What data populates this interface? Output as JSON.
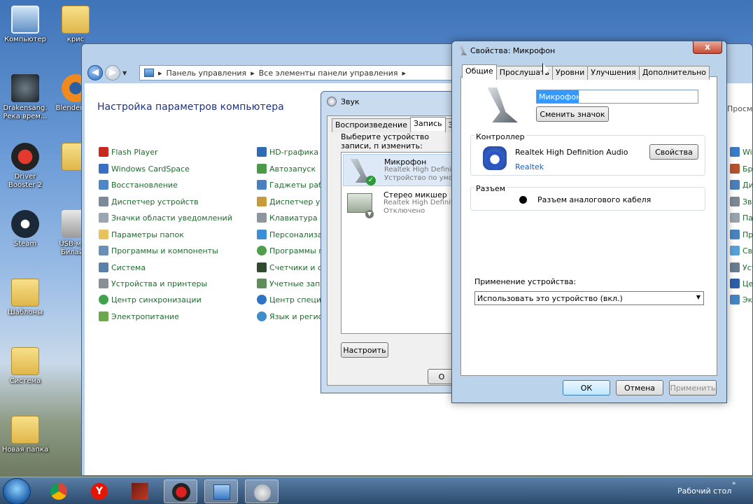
{
  "desktop": {
    "icons": [
      {
        "label": "Компьютер"
      },
      {
        "label": "крис"
      },
      {
        "label": "Drakensang. Река врем..."
      },
      {
        "label": "Blender.e..."
      },
      {
        "label": "Driver Booster 2"
      },
      {
        "label": "Steam"
      },
      {
        "label": "USB-мо... Билай..."
      },
      {
        "label": "Шаблоны"
      },
      {
        "label": "Система"
      },
      {
        "label": "Новая папка"
      }
    ]
  },
  "control_panel": {
    "breadcrumb": [
      "Панель управления",
      "Все элементы панели управления"
    ],
    "title": "Настройка параметров компьютера",
    "right_hint": "Просмо",
    "col1": [
      "Flash Player",
      "Windows CardSpace",
      "Восстановление",
      "Диспетчер устройств",
      "Значки области уведомлений",
      "Параметры папок",
      "Программы и компоненты",
      "Система",
      "Устройства и принтеры",
      "Центр синхронизации",
      "Электропитание"
    ],
    "col2": [
      "HD-графика Int",
      "Автозапуск",
      "Гаджеты рабоч",
      "Диспетчер уче",
      "Клавиатура",
      "Персонализац",
      "Программы по",
      "Счетчики и ср",
      "Учетные запис",
      "Центр специал",
      "Язык и регион"
    ],
    "col3": [
      "Win",
      "Бра",
      "Ди",
      "Зву",
      "Па",
      "Пр",
      "Св",
      "Уст",
      "Цен",
      "Экр"
    ]
  },
  "sound_dialog": {
    "title": "Звук",
    "tabs": [
      "Воспроизведение",
      "Запись",
      "Звуки"
    ],
    "instruction": "Выберите устройство записи, п изменить:",
    "devices": [
      {
        "name": "Микрофон",
        "driver": "Realtek High Definit",
        "status": "Устройство по умол"
      },
      {
        "name": "Стерео микшер",
        "driver": "Realtek High Definit",
        "status": "Отключено"
      }
    ],
    "configure_label": "Настроить",
    "ok_partial": "О"
  },
  "mic_props": {
    "title": "Свойства: Микрофон",
    "close": "x",
    "tabs": [
      "Общие",
      "Прослушать",
      "Уровни",
      "Улучшения",
      "Дополнительно"
    ],
    "name_value": "Микрофон",
    "change_icon_label": "Сменить значок",
    "controller": {
      "label": "Контроллер",
      "device": "Realtek High Definition Audio",
      "vendor": "Realtek",
      "props_label": "Свойства"
    },
    "jack": {
      "label": "Разъем",
      "value": "Разъем аналогового кабеля"
    },
    "usage": {
      "label": "Применение устройства:",
      "selected": "Использовать это устройство (вкл.)"
    },
    "buttons": {
      "ok": "ОК",
      "cancel": "Отмена",
      "apply": "Применить"
    }
  },
  "taskbar": {
    "desktop_label": "Рабочий стол"
  }
}
